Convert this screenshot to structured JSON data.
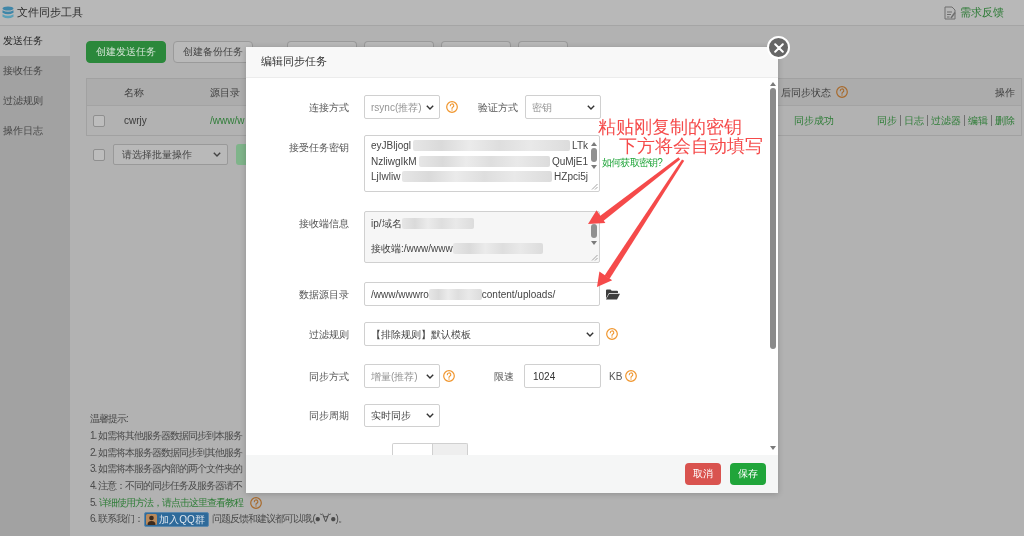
{
  "window": {
    "title": "文件同步工具",
    "feedback_link": "需求反馈"
  },
  "sidebar": {
    "items": [
      {
        "label": "发送任务",
        "selected": true
      },
      {
        "label": "接收任务",
        "selected": false
      },
      {
        "label": "过滤规则",
        "selected": false
      },
      {
        "label": "操作日志",
        "selected": false
      }
    ]
  },
  "toolbar": {
    "buttons": [
      {
        "label": "创建发送任务",
        "kind": "primary"
      },
      {
        "label": "创建备份任务",
        "kind": "outline"
      },
      {
        "kind": "outline"
      },
      {
        "kind": "outline"
      },
      {
        "kind": "outline"
      },
      {
        "kind": "outline"
      }
    ]
  },
  "table": {
    "columns": [
      {
        "label": "名称"
      },
      {
        "label": "源目录"
      },
      {
        "label": "后同步状态",
        "help": true
      },
      {
        "label": "操作"
      }
    ],
    "rows": [
      {
        "checked": false,
        "name": "cwrjy",
        "source": "/www/w",
        "status": "同步成功",
        "actions": [
          "同步",
          "日志",
          "过滤器",
          "编辑",
          "删除"
        ]
      }
    ]
  },
  "batch": {
    "checked": false,
    "select": "请选择批量操作"
  },
  "tips": {
    "title": "温馨提示:",
    "lines": [
      {
        "kind": "text",
        "text": "1. 如需将其他服务器数据同步到本服务"
      },
      {
        "kind": "text",
        "text": "2. 如需将本服务器数据同步到其他服务"
      },
      {
        "kind": "text",
        "text": "3. 如需将本服务器内部的两个文件夹的"
      },
      {
        "kind": "text",
        "text": "4. 注意：不同的同步任务及服务器请不"
      },
      {
        "kind": "link",
        "prefix": "5.",
        "text": "详细使用方法，请点击这里查看教程",
        "help": true
      },
      {
        "kind": "contact",
        "prefix": "6. 联系我们：",
        "badge": "加入QQ群",
        "text": "问题反馈和建议都可以哦.(●ˇ∀ˇ●)。"
      }
    ]
  },
  "dialog": {
    "title": "编辑同步任务",
    "connection": {
      "label": "连接方式",
      "value": "rsync(推荐)",
      "disabled": true,
      "help": true
    },
    "auth": {
      "label": "验证方式",
      "value": "密钥",
      "disabled": true
    },
    "key": {
      "label": "接受任务密钥",
      "lines": [
        {
          "start": "eyJBljogl",
          "redacted": true,
          "end": "LTk"
        },
        {
          "start": "NzliwgIkM",
          "redacted": true,
          "end": "QuMjE1"
        },
        {
          "start": "LjIwliw",
          "redacted": true,
          "end": "HZpci5j"
        }
      ],
      "link": "如何获取密钥?"
    },
    "receiver": {
      "label": "接收端信息",
      "lines": [
        {
          "start": "ip/域名",
          "redacted": true
        },
        {
          "start": "接收端:/www/www",
          "redacted": true
        }
      ]
    },
    "source_dir": {
      "label": "数据源目录",
      "start": "/www/wwwro",
      "redacted": true,
      "end": "content/uploads/"
    },
    "filter": {
      "label": "过滤规则",
      "value": "【排除规则】默认模板",
      "disabled": false,
      "help": true
    },
    "sync_mode": {
      "label": "同步方式",
      "value": "增量(推荐)",
      "disabled": true,
      "help": true
    },
    "speed_limit": {
      "label": "限速",
      "value": "1024",
      "unit": "KB",
      "help": true
    },
    "sync_cycle": {
      "label": "同步周期",
      "value": "实时同步",
      "disabled": false
    },
    "buttons": [
      {
        "label": "取消",
        "kind": "cancel"
      },
      {
        "label": "保存",
        "kind": "save"
      }
    ]
  },
  "annotation": {
    "lines": [
      "粘贴刚复制的密钥",
      "下方将会自动填写"
    ]
  }
}
